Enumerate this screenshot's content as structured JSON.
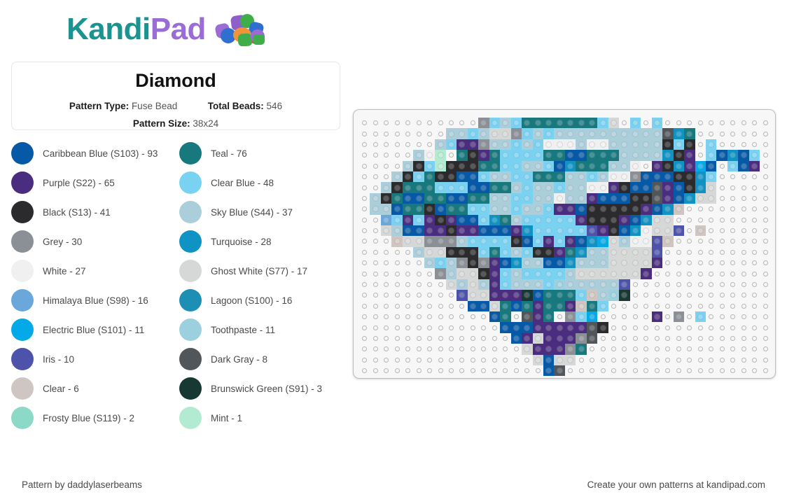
{
  "brand": {
    "name_first": "Kandi",
    "name_second": "Pad",
    "logo_icon": "beads-pile-icon",
    "color_first": "#1a9391",
    "color_second": "#9b6bd6"
  },
  "info_card": {
    "title": "Diamond",
    "pattern_type_label": "Pattern Type:",
    "pattern_type_value": "Fuse Bead",
    "total_beads_label": "Total Beads:",
    "total_beads_value": "546",
    "pattern_size_label": "Pattern Size:",
    "pattern_size_value": "38x24"
  },
  "legend": [
    {
      "name": "Caribbean Blue (S103) - 93",
      "color": "#0659a6",
      "key": "A"
    },
    {
      "name": "Teal - 76",
      "color": "#17787e",
      "key": "B"
    },
    {
      "name": "Purple (S22) - 65",
      "color": "#4b2d7f",
      "key": "C"
    },
    {
      "name": "Clear Blue - 48",
      "color": "#79d2f2",
      "key": "D"
    },
    {
      "name": "Black (S13) - 41",
      "color": "#2b2b2d",
      "key": "E"
    },
    {
      "name": "Sky Blue (S44) - 37",
      "color": "#abcedb",
      "key": "F"
    },
    {
      "name": "Grey - 30",
      "color": "#8b9096",
      "key": "G"
    },
    {
      "name": "Turquoise - 28",
      "color": "#0e93c4",
      "key": "H"
    },
    {
      "name": "White - 27",
      "color": "#f0f0f0",
      "key": "I"
    },
    {
      "name": "Ghost White (S77) - 17",
      "color": "#d5d8d6",
      "key": "J"
    },
    {
      "name": "Himalaya Blue (S98) - 16",
      "color": "#6aa8db",
      "key": "K"
    },
    {
      "name": "Lagoon (S100) - 16",
      "color": "#1d8fb5",
      "key": "L"
    },
    {
      "name": "Electric Blue (S101) - 11",
      "color": "#04a9e8",
      "key": "M"
    },
    {
      "name": "Toothpaste - 11",
      "color": "#9cd0de",
      "key": "N"
    },
    {
      "name": "Iris - 10",
      "color": "#4d53ab",
      "key": "O"
    },
    {
      "name": "Dark Gray - 8",
      "color": "#51565a",
      "key": "P"
    },
    {
      "name": "Clear - 6",
      "color": "#d0c6c1",
      "key": "Q"
    },
    {
      "name": "Brunswick Green (S91) - 3",
      "color": "#173833",
      "key": "R"
    },
    {
      "name": "Frosty Blue (S119) - 2",
      "color": "#8bd9c6",
      "key": "S"
    },
    {
      "name": "Mint - 1",
      "color": "#b3ebd2",
      "key": "T"
    }
  ],
  "board": {
    "columns": 38,
    "rows": 24,
    "palette": {
      "A": "#0659a6",
      "B": "#17787e",
      "C": "#4b2d7f",
      "D": "#79d2f2",
      "E": "#2b2b2d",
      "F": "#abcedb",
      "G": "#8b9096",
      "H": "#0e93c4",
      "I": "#f0f0f0",
      "J": "#d5d8d6",
      "K": "#6aa8db",
      "L": "#1d8fb5",
      "M": "#04a9e8",
      "N": "#9cd0de",
      "O": "#4d53ab",
      "P": "#51565a",
      "Q": "#d0c6c1",
      "R": "#173833",
      "S": "#8bd9c6",
      "T": "#b3ebd2"
    },
    "rows_data": [
      "...........GDFDBBBBBBBDJ.D.D..........",
      "........FFDFJJGDFDFFFFFFFFFFPHB.......",
      ".......FDCCGFFDFDIIIFIIFFFFFEDE.D.....",
      ".....FIT BECBDDDDBBAABBBFFFFHEC DAHAD.",
      "....FEDTEEEBBDDFFDAHBBBFFI CEHCMA DAC.",
      "...FEDBEEAADFFDDBBBFFDFIIGAAAEEHD.....",
      "..FEBBBDDDAABBFDFFDFFIICEAAPCAEHJ.....",
      ".FEBAABBAABBFFDDFFIFFCAAAEEPCAHJJ.....",
      ".FFABBEABBDDFFDFFDCCAEEEEECAHQ........",
      "..KDCDCECAADHBFDDDDDCEEECAHJJ.........",
      "..JFAACCECCAAACHDDDDDOCEAHIJJO.Q......",
      "...QJJGGGFDDDDEADCDCAHMJFIIOQ.........",
      ".....FJJEEEDBDFDEECBHFFJJJJO..........",
      "......FDFGEGCAHFFAAHFFFJJJJC..........",
      ".......GFJJECDFDDDDFJJJJJJC...........",
      "........JFJFCDFFFDNFFFFFO.............",
      ".........OJJCCCRABBBDQFNR.............",
      "..........AAJBABCBBCQBD...............",
      "............AB PCB GDM.. ..C.G.D......",
      ".............AAACCCCCPE...............",
      "..............ACJCCCGP................",
      "...............JCCCGB.................",
      "................JAJJ..................",
      ".................AP..................."
    ]
  },
  "footer": {
    "left": "Pattern by daddylaserbeams",
    "right": "Create your own patterns at kandipad.com"
  }
}
